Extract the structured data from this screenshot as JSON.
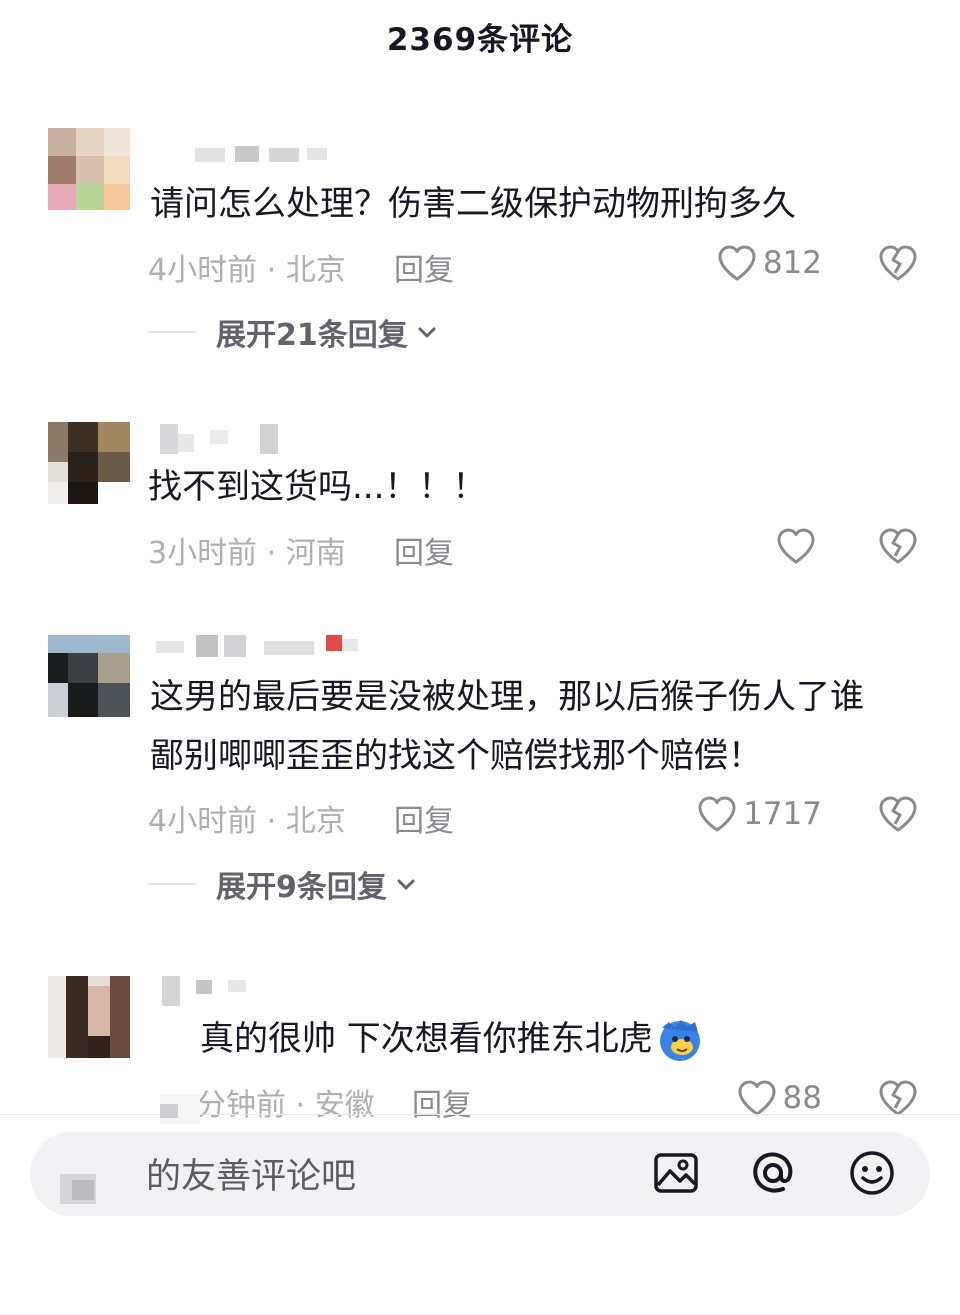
{
  "header": {
    "title": "2369条评论"
  },
  "comments": [
    {
      "text_lines": [
        "请问怎么处理？伤害二级保护动物刑拘多久"
      ],
      "meta": "4小时前 · 北京",
      "reply_label": "回复",
      "like_count": "812",
      "expand_label": "展开21条回复"
    },
    {
      "text_lines": [
        "找不到这货吗...！！！"
      ],
      "meta": "3小时前 · 河南",
      "reply_label": "回复",
      "like_count": ""
    },
    {
      "text_lines": [
        "这男的最后要是没被处理，那以后猴子伤人了谁",
        "鄙别唧唧歪歪的找这个赔偿找那个赔偿！"
      ],
      "meta": "4小时前 · 北京",
      "reply_label": "回复",
      "like_count": "1717",
      "expand_label": "展开9条回复"
    },
    {
      "text_lines": [
        "真的很帅 下次想看你推东北虎"
      ],
      "meta": "分钟前 · 安徽",
      "reply_label": "回复",
      "like_count": "88"
    }
  ],
  "input_bar": {
    "placeholder": "的友善评论吧"
  },
  "icons": {
    "like": "heart-outline-icon",
    "dislike": "broken-heart-icon",
    "expand": "chevron-down-icon",
    "image": "image-icon",
    "mention": "at-icon",
    "emoji": "smiley-icon",
    "tiger_emoji": "tiger-face-emoji"
  },
  "colors": {
    "primary_text": "#161823",
    "secondary_text": "#aeaeb3",
    "icon": "#8a8b91"
  }
}
